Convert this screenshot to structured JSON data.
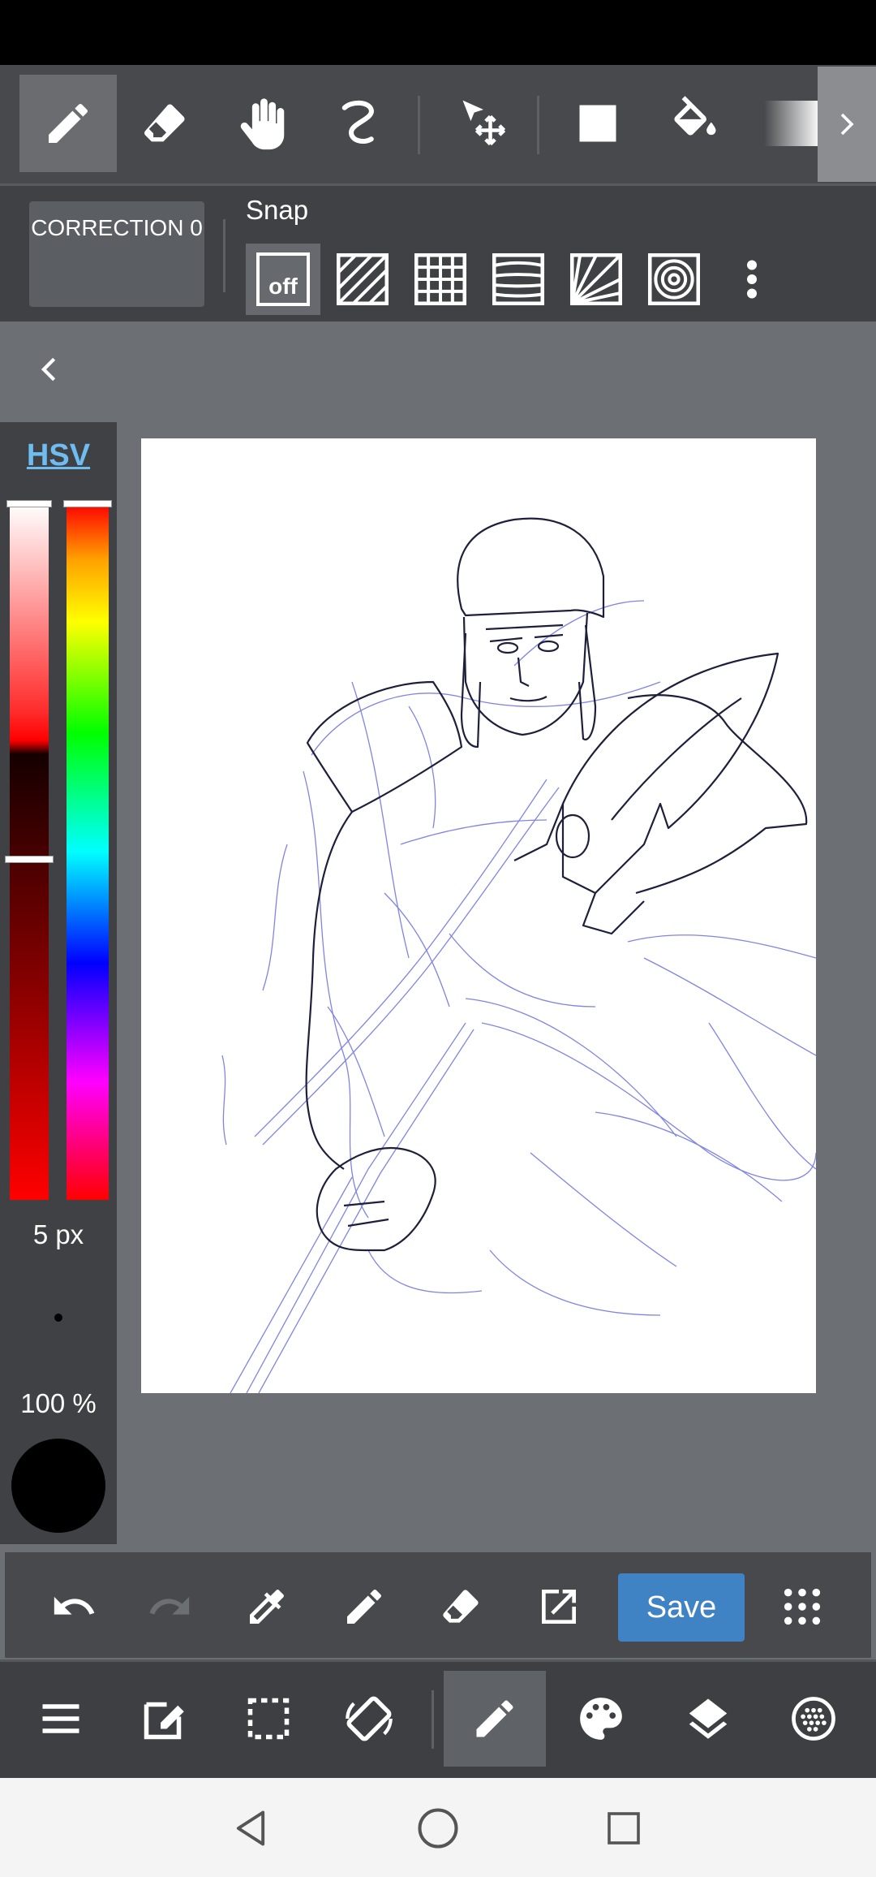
{
  "toolbar": {
    "tools": [
      {
        "name": "pen-tool",
        "active": true
      },
      {
        "name": "eraser-tool",
        "active": false
      },
      {
        "name": "hand-tool",
        "active": false
      },
      {
        "name": "lasso-tool",
        "active": false
      },
      {
        "name": "move-tool",
        "active": false
      },
      {
        "name": "fill-shape-tool",
        "active": false
      },
      {
        "name": "bucket-tool",
        "active": false
      },
      {
        "name": "gradient-tool",
        "active": false
      }
    ]
  },
  "subbar": {
    "correction_label": "CORRECTION 0",
    "snap_label": "Snap",
    "snap_off_text": "off",
    "snap_active": "off"
  },
  "color_panel": {
    "mode_label": "HSV",
    "brush_size": "5 px",
    "opacity": "100 %",
    "current_color": "#000000"
  },
  "actions": {
    "save_label": "Save"
  },
  "colors": {
    "accent": "#3f83c4",
    "sketch_line": "#5a5fd6",
    "ink_line": "#1a1a2e"
  }
}
